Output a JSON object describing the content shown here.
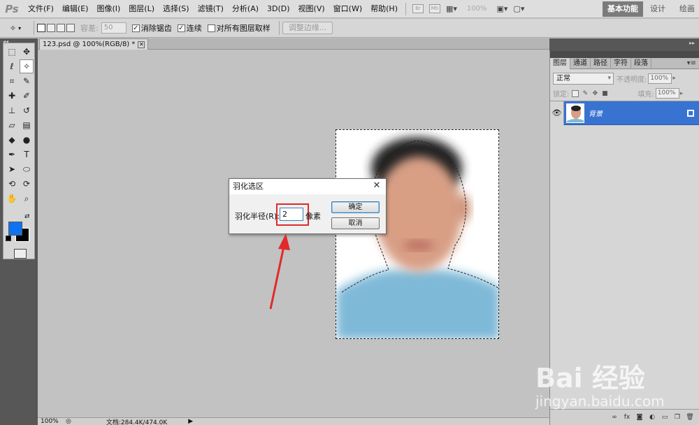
{
  "app": {
    "logo": "Ps"
  },
  "menu": [
    "文件(F)",
    "编辑(E)",
    "图像(I)",
    "图层(L)",
    "选择(S)",
    "滤镜(T)",
    "分析(A)",
    "3D(D)",
    "视图(V)",
    "窗口(W)",
    "帮助(H)"
  ],
  "menubar": {
    "zoom": "100%",
    "workspaces": {
      "basic": "基本功能",
      "design": "设计",
      "paint": "绘画"
    }
  },
  "options": {
    "tolerance_label": "容差:",
    "tolerance_value": "50",
    "anti_alias": "消除锯齿",
    "contiguous": "连续",
    "sample_all": "对所有图层取样",
    "refine_edge": "调整边缘..."
  },
  "document": {
    "tab_title": "123.psd @ 100%(RGB/8) *",
    "status_zoom": "100%",
    "status_doc": "文档:284.4K/474.0K"
  },
  "dialog": {
    "title": "羽化选区",
    "radius_label": "羽化半径(R):",
    "radius_value": "2",
    "unit": "像素",
    "ok": "确定",
    "cancel": "取消"
  },
  "layers_panel": {
    "tabs": [
      "图层",
      "通道",
      "路径",
      "字符",
      "段落"
    ],
    "blend_mode": "正常",
    "opacity_label": "不透明度:",
    "opacity_value": "100%",
    "lock_label": "锁定:",
    "fill_label": "填充:",
    "fill_value": "100%",
    "layer_name": "背景"
  },
  "colors": {
    "foreground": "#0f73f0",
    "background": "#000000",
    "layer_selected": "#3873d2",
    "highlight": "#e12a2a"
  },
  "watermark": {
    "brand": "Bai 经验",
    "url": "jingyan.baidu.com"
  }
}
